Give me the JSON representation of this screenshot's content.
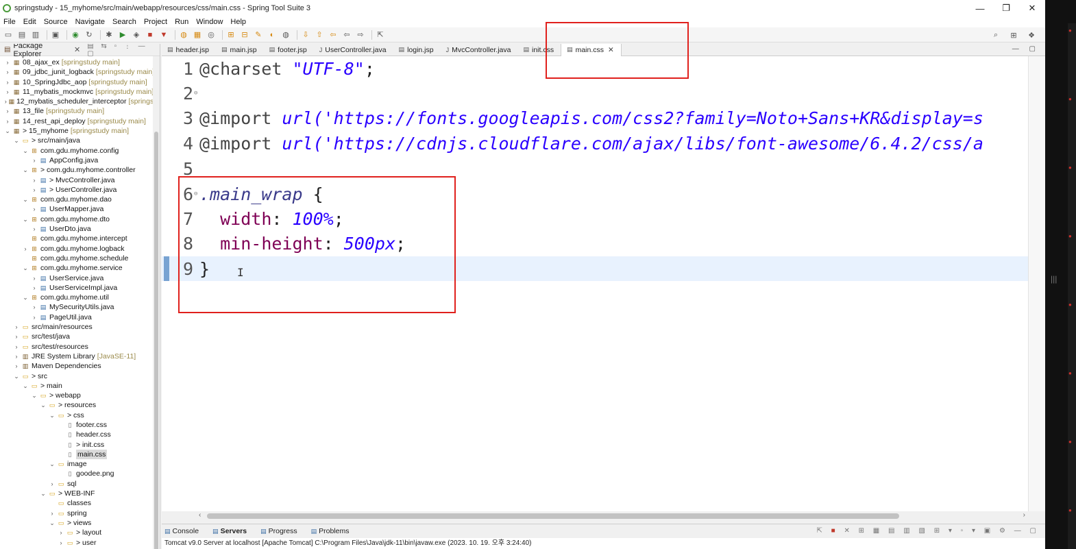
{
  "window": {
    "title": "springstudy - 15_myhome/src/main/webapp/resources/css/main.css - Spring Tool Suite 3",
    "minimize": "—",
    "restore": "❐",
    "close": "✕"
  },
  "menu": [
    "File",
    "Edit",
    "Source",
    "Navigate",
    "Search",
    "Project",
    "Run",
    "Window",
    "Help"
  ],
  "explorer": {
    "title": "Package Explorer",
    "items": [
      {
        "depth": 0,
        "expanded": false,
        "icon": "proj",
        "label": "08_ajax_ex",
        "deco": "[springstudy main]"
      },
      {
        "depth": 0,
        "expanded": false,
        "icon": "proj",
        "label": "09_jdbc_junit_logback",
        "deco": "[springstudy main]"
      },
      {
        "depth": 0,
        "expanded": false,
        "icon": "proj",
        "label": "10_SpringJdbc_aop",
        "deco": "[springstudy main]"
      },
      {
        "depth": 0,
        "expanded": false,
        "icon": "proj",
        "label": "11_mybatis_mockmvc",
        "deco": "[springstudy main]"
      },
      {
        "depth": 0,
        "expanded": false,
        "icon": "proj",
        "label": "12_mybatis_scheduler_interceptor",
        "deco": "[springstu"
      },
      {
        "depth": 0,
        "expanded": false,
        "icon": "proj",
        "label": "13_file",
        "deco": "[springstudy main]"
      },
      {
        "depth": 0,
        "expanded": false,
        "icon": "proj",
        "label": "14_rest_api_deploy",
        "deco": "[springstudy main]"
      },
      {
        "depth": 0,
        "expanded": true,
        "icon": "proj",
        "label": "> 15_myhome",
        "deco": "[springstudy main]"
      },
      {
        "depth": 1,
        "expanded": true,
        "icon": "folder",
        "label": "> src/main/java",
        "deco": ""
      },
      {
        "depth": 2,
        "expanded": true,
        "icon": "pkg",
        "label": "com.gdu.myhome.config",
        "deco": ""
      },
      {
        "depth": 3,
        "expanded": false,
        "icon": "java",
        "label": "AppConfig.java",
        "deco": ""
      },
      {
        "depth": 2,
        "expanded": true,
        "icon": "pkg",
        "label": "> com.gdu.myhome.controller",
        "deco": ""
      },
      {
        "depth": 3,
        "expanded": false,
        "icon": "java",
        "label": "> MvcController.java",
        "deco": ""
      },
      {
        "depth": 3,
        "expanded": false,
        "icon": "java",
        "label": "> UserController.java",
        "deco": ""
      },
      {
        "depth": 2,
        "expanded": true,
        "icon": "pkg",
        "label": "com.gdu.myhome.dao",
        "deco": ""
      },
      {
        "depth": 3,
        "expanded": false,
        "icon": "java",
        "label": "UserMapper.java",
        "deco": ""
      },
      {
        "depth": 2,
        "expanded": true,
        "icon": "pkg",
        "label": "com.gdu.myhome.dto",
        "deco": ""
      },
      {
        "depth": 3,
        "expanded": false,
        "icon": "java",
        "label": "UserDto.java",
        "deco": ""
      },
      {
        "depth": 2,
        "expanded": null,
        "icon": "pkg",
        "label": "com.gdu.myhome.intercept",
        "deco": ""
      },
      {
        "depth": 2,
        "expanded": false,
        "icon": "pkg",
        "label": "com.gdu.myhome.logback",
        "deco": ""
      },
      {
        "depth": 2,
        "expanded": null,
        "icon": "pkg",
        "label": "com.gdu.myhome.schedule",
        "deco": ""
      },
      {
        "depth": 2,
        "expanded": true,
        "icon": "pkg",
        "label": "com.gdu.myhome.service",
        "deco": ""
      },
      {
        "depth": 3,
        "expanded": false,
        "icon": "java",
        "label": "UserService.java",
        "deco": ""
      },
      {
        "depth": 3,
        "expanded": false,
        "icon": "java",
        "label": "UserServiceImpl.java",
        "deco": ""
      },
      {
        "depth": 2,
        "expanded": true,
        "icon": "pkg",
        "label": "com.gdu.myhome.util",
        "deco": ""
      },
      {
        "depth": 3,
        "expanded": false,
        "icon": "java",
        "label": "MySecurityUtils.java",
        "deco": ""
      },
      {
        "depth": 3,
        "expanded": false,
        "icon": "java",
        "label": "PageUtil.java",
        "deco": ""
      },
      {
        "depth": 1,
        "expanded": false,
        "icon": "folder",
        "label": "src/main/resources",
        "deco": ""
      },
      {
        "depth": 1,
        "expanded": false,
        "icon": "folder",
        "label": "src/test/java",
        "deco": ""
      },
      {
        "depth": 1,
        "expanded": false,
        "icon": "folder",
        "label": "src/test/resources",
        "deco": ""
      },
      {
        "depth": 1,
        "expanded": false,
        "icon": "lib",
        "label": "JRE System Library",
        "deco": "[JavaSE-11]"
      },
      {
        "depth": 1,
        "expanded": false,
        "icon": "lib",
        "label": "Maven Dependencies",
        "deco": ""
      },
      {
        "depth": 1,
        "expanded": true,
        "icon": "folder",
        "label": "> src",
        "deco": ""
      },
      {
        "depth": 2,
        "expanded": true,
        "icon": "folder",
        "label": "> main",
        "deco": ""
      },
      {
        "depth": 3,
        "expanded": true,
        "icon": "folder",
        "label": "> webapp",
        "deco": ""
      },
      {
        "depth": 4,
        "expanded": true,
        "icon": "folder",
        "label": "> resources",
        "deco": ""
      },
      {
        "depth": 5,
        "expanded": true,
        "icon": "folder",
        "label": "> css",
        "deco": ""
      },
      {
        "depth": 6,
        "expanded": null,
        "icon": "file",
        "label": "footer.css",
        "deco": ""
      },
      {
        "depth": 6,
        "expanded": null,
        "icon": "file",
        "label": "header.css",
        "deco": ""
      },
      {
        "depth": 6,
        "expanded": null,
        "icon": "file",
        "label": "> init.css",
        "deco": ""
      },
      {
        "depth": 6,
        "expanded": null,
        "icon": "file",
        "label": "main.css",
        "deco": "",
        "selected": true
      },
      {
        "depth": 5,
        "expanded": true,
        "icon": "folder",
        "label": "image",
        "deco": ""
      },
      {
        "depth": 6,
        "expanded": null,
        "icon": "file",
        "label": "goodee.png",
        "deco": ""
      },
      {
        "depth": 5,
        "expanded": false,
        "icon": "folder",
        "label": "sql",
        "deco": ""
      },
      {
        "depth": 4,
        "expanded": true,
        "icon": "folder",
        "label": "> WEB-INF",
        "deco": ""
      },
      {
        "depth": 5,
        "expanded": null,
        "icon": "folder",
        "label": "classes",
        "deco": ""
      },
      {
        "depth": 5,
        "expanded": false,
        "icon": "folder",
        "label": "spring",
        "deco": ""
      },
      {
        "depth": 5,
        "expanded": true,
        "icon": "folder",
        "label": "> views",
        "deco": ""
      },
      {
        "depth": 6,
        "expanded": false,
        "icon": "folder",
        "label": "> layout",
        "deco": ""
      },
      {
        "depth": 6,
        "expanded": false,
        "icon": "folder",
        "label": "> user",
        "deco": ""
      }
    ]
  },
  "tabs": [
    {
      "label": "header.jsp",
      "active": false
    },
    {
      "label": "main.jsp",
      "active": false
    },
    {
      "label": "footer.jsp",
      "active": false
    },
    {
      "label": "UserController.java",
      "active": false
    },
    {
      "label": "login.jsp",
      "active": false
    },
    {
      "label": "MvcController.java",
      "active": false
    },
    {
      "label": "init.css",
      "active": false
    },
    {
      "label": "main.css",
      "active": true
    }
  ],
  "editor": {
    "lines": [
      {
        "n": "1",
        "fold": "",
        "tokens": [
          [
            "tok-at",
            "@charset "
          ],
          [
            "tok-str",
            "\"UTF-8\""
          ],
          [
            "",
            ";"
          ]
        ]
      },
      {
        "n": "2",
        "fold": "⊖",
        "tokens": []
      },
      {
        "n": "3",
        "fold": "",
        "tokens": [
          [
            "tok-at",
            "@import "
          ],
          [
            "tok-url",
            "url('https://fonts.googleapis.com/css2?family=Noto+Sans+KR&display=s"
          ]
        ]
      },
      {
        "n": "4",
        "fold": "",
        "tokens": [
          [
            "tok-at",
            "@import "
          ],
          [
            "tok-url",
            "url('https://cdnjs.cloudflare.com/ajax/libs/font-awesome/6.4.2/css/a"
          ]
        ]
      },
      {
        "n": "5",
        "fold": "",
        "tokens": []
      },
      {
        "n": "6",
        "fold": "⊖",
        "tokens": [
          [
            "tok-sel",
            ".main_wrap"
          ],
          [
            "",
            " {"
          ]
        ]
      },
      {
        "n": "7",
        "fold": "",
        "tokens": [
          [
            "",
            "  "
          ],
          [
            "tok-prop",
            "width"
          ],
          [
            "",
            ": "
          ],
          [
            "tok-val",
            "100%"
          ],
          [
            "",
            ";"
          ]
        ]
      },
      {
        "n": "8",
        "fold": "",
        "tokens": [
          [
            "",
            "  "
          ],
          [
            "tok-prop",
            "min-height"
          ],
          [
            "",
            ": "
          ],
          [
            "tok-val",
            "500px"
          ],
          [
            "",
            ";"
          ]
        ]
      },
      {
        "n": "9",
        "fold": "",
        "tokens": [
          [
            "",
            "}"
          ]
        ],
        "current": true
      }
    ],
    "cursor_glyph": "I"
  },
  "console": {
    "tabs": [
      "Console",
      "Servers",
      "Progress",
      "Problems"
    ],
    "active_tab": "Servers",
    "status": "Tomcat v9.0 Server at localhost [Apache Tomcat] C:\\Program Files\\Java\\jdk-11\\bin\\javaw.exe  (2023. 10. 19. 오후 3:24:40)"
  },
  "colors": {
    "highlight_box": "#e0201c",
    "current_line": "#e8f2fe",
    "string": "#2a00ff",
    "property": "#7f0055"
  }
}
